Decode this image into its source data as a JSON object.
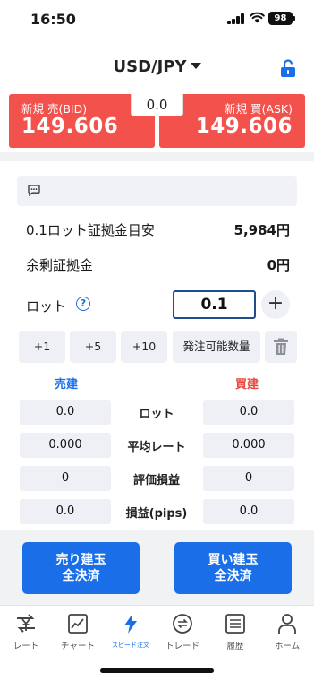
{
  "status_bar": {
    "time": "16:50",
    "battery": "98"
  },
  "header": {
    "currency_pair": "USD/JPY"
  },
  "prices": {
    "bid_label": "新規 売(BID)",
    "bid_value": "149.606",
    "ask_label": "新規 買(ASK)",
    "ask_value": "149.606",
    "spread": "0.0"
  },
  "margin": {
    "rows": [
      {
        "label": "0.1ロット証拠金目安",
        "value": "5,984円"
      },
      {
        "label": "余剰証拠金",
        "value": "0円"
      }
    ]
  },
  "lot": {
    "label": "ロット",
    "help": "?",
    "value": "0.1",
    "plus": "+"
  },
  "quick_buttons": [
    "+1",
    "+5",
    "+10",
    "発注可能数量"
  ],
  "position_table": {
    "sell_header": "売建",
    "buy_header": "買建",
    "rows": [
      {
        "label": "ロット",
        "sell": "0.0",
        "buy": "0.0"
      },
      {
        "label": "平均レート",
        "sell": "0.000",
        "buy": "0.000"
      },
      {
        "label": "評価損益",
        "sell": "0",
        "buy": "0"
      },
      {
        "label": "損益(pips)",
        "sell": "0.0",
        "buy": "0.0"
      }
    ]
  },
  "settle_buttons": {
    "sell": {
      "line1": "売り建玉",
      "line2": "全決済"
    },
    "buy": {
      "line1": "買い建玉",
      "line2": "全決済"
    }
  },
  "tabs": [
    {
      "label": "レート",
      "icon": "yen-arrows-icon"
    },
    {
      "label": "チャート",
      "icon": "chart-icon"
    },
    {
      "label": "スピード注文",
      "icon": "lightning-icon"
    },
    {
      "label": "トレード",
      "icon": "exchange-icon"
    },
    {
      "label": "履歴",
      "icon": "history-list-icon"
    },
    {
      "label": "ホーム",
      "icon": "person-icon"
    }
  ],
  "colors": {
    "price_red": "#f2514c",
    "accent_blue": "#1a6fe8",
    "sell_blue": "#1a6fe8",
    "buy_red": "#e8453c"
  }
}
